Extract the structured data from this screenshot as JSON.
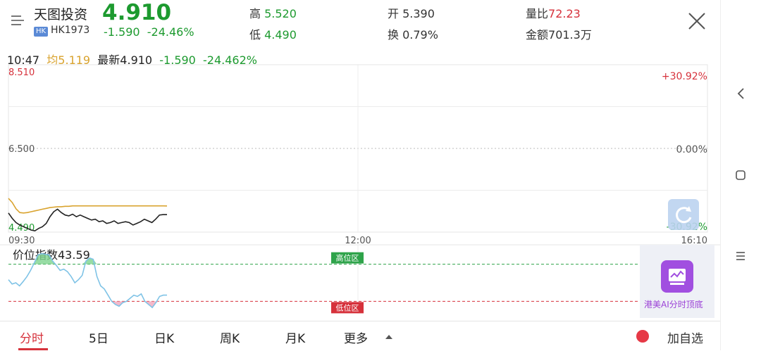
{
  "header": {
    "stock_name": "天图投资",
    "market_badge": "HK",
    "stock_code": "HK1973",
    "price": "4.910",
    "change_abs": "-1.590",
    "change_pct": "-24.46%",
    "high_label": "高",
    "high_value": "5.520",
    "low_label": "低",
    "low_value": "4.490",
    "open_label": "开",
    "open_value": "5.390",
    "turnover_label": "换",
    "turnover_value": "0.79%",
    "volratio_label": "量比",
    "volratio_value": "72.23",
    "amount_label": "金额",
    "amount_value": "701.3万"
  },
  "subinfo": {
    "time": "10:47",
    "avg_label": "均",
    "avg_value": "5.119",
    "latest_label": "最新",
    "latest_value": "4.910",
    "change_abs": "-1.590",
    "change_pct": "-24.462%"
  },
  "chart_data": [
    {
      "type": "line",
      "title": "",
      "y_left_ticks": [
        "8.510",
        "6.500",
        "4.490"
      ],
      "y_right_ticks": [
        "+30.92%",
        "0.00%",
        "-30.92%"
      ],
      "x_ticks": [
        "09:30",
        "12:00",
        "16:10"
      ],
      "ylim": [
        4.49,
        8.51
      ],
      "grid": true,
      "series": [
        {
          "values": [
            4.95,
            4.82,
            4.72,
            4.66,
            4.62,
            4.58,
            4.54,
            4.52,
            4.58,
            4.62,
            4.7,
            4.86,
            4.98,
            5.04,
            4.96,
            4.9,
            4.88,
            4.92,
            4.86,
            4.9,
            4.86,
            4.82,
            4.78,
            4.8,
            4.74,
            4.76,
            4.7,
            4.72,
            4.76,
            4.7,
            4.72,
            4.74,
            4.72,
            4.66,
            4.7,
            4.74,
            4.8,
            4.76,
            4.72,
            4.8,
            4.9,
            4.91,
            4.91
          ],
          "color": "#222222"
        },
        {
          "values": [
            5.3,
            5.2,
            5.05,
            4.96,
            4.95,
            4.96,
            4.98,
            5.0,
            5.02,
            5.04,
            5.06,
            5.08,
            5.09,
            5.1,
            5.1,
            5.11,
            5.11,
            5.12,
            5.12,
            5.12,
            5.12,
            5.12,
            5.12,
            5.12,
            5.12,
            5.12,
            5.12,
            5.12,
            5.12,
            5.12,
            5.12,
            5.12,
            5.12,
            5.12,
            5.12,
            5.12,
            5.12,
            5.12,
            5.12,
            5.12,
            5.12,
            5.12,
            5.119
          ],
          "color": "#d9a32e"
        }
      ]
    },
    {
      "type": "line",
      "title": "价位指数43.59",
      "ylim": [
        0,
        100
      ],
      "reference_lines": [
        {
          "label": "高位区",
          "value": 80
        },
        {
          "label": "低位区",
          "value": 20
        }
      ],
      "series": [
        {
          "values": [
            55,
            48,
            50,
            45,
            52,
            60,
            70,
            82,
            95,
            97,
            96,
            95,
            85,
            78,
            70,
            72,
            68,
            60,
            50,
            55,
            62,
            85,
            90,
            88,
            60,
            45,
            40,
            30,
            20,
            15,
            12,
            18,
            20,
            25,
            30,
            28,
            32,
            20,
            15,
            10,
            18,
            28,
            30,
            30
          ],
          "color": "#7fc3e6"
        }
      ]
    }
  ],
  "index_label": "价位指数",
  "index_value": "43.59",
  "zones": {
    "high": "高位区",
    "low": "低位区"
  },
  "ai": {
    "label": "港美AI分时顶底"
  },
  "tabs": [
    {
      "label": "分时",
      "active": true
    },
    {
      "label": "5日"
    },
    {
      "label": "日K"
    },
    {
      "label": "周K"
    },
    {
      "label": "月K"
    },
    {
      "label": "更多"
    }
  ],
  "add_watch": "加自选",
  "colors": {
    "up": "#d6313b",
    "down": "#1d9a2f",
    "avg": "#d9a32e"
  }
}
